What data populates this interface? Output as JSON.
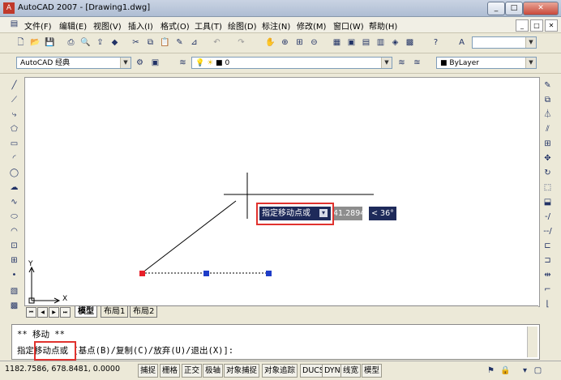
{
  "title_bar": {
    "title": "AutoCAD 2007 - [Drawing1.dwg]",
    "min": "_",
    "max": "□",
    "close": "✕"
  },
  "menu": [
    "文件(F)",
    "编辑(E)",
    "视图(V)",
    "插入(I)",
    "格式(O)",
    "工具(T)",
    "绘图(D)",
    "标注(N)",
    "修改(M)",
    "窗口(W)",
    "帮助(H)"
  ],
  "doc_controls": {
    "min": "_",
    "max": "□",
    "close": "✕"
  },
  "workspace": {
    "value": "AutoCAD 经典"
  },
  "layer": {
    "value": "0"
  },
  "color": {
    "value": "ByLayer"
  },
  "canvas": {
    "tooltip_label": "指定移动点或",
    "tooltip_dropdown": "▾",
    "coord_input": "41.2894",
    "angle_input": "< 36°",
    "ucs_x": "X",
    "ucs_y": "Y"
  },
  "tabs": {
    "model": "模型",
    "layout1": "布局1",
    "layout2": "布局2"
  },
  "command": {
    "line1": "** 移动 **",
    "line2": "指定移动点或 [基点(B)/复制(C)/放弃(U)/退出(X)]:"
  },
  "status": {
    "coords": "1182.7586, 678.8481, 0.0000",
    "buttons": [
      "捕捉",
      "栅格",
      "正交",
      "极轴",
      "对象捕捉",
      "对象追踪",
      "DUCS",
      "DYN",
      "线宽",
      "模型"
    ]
  },
  "colors": {
    "canvas_bg": "#ffffff",
    "grip_hot": "#e8202a",
    "grip_cold": "#1e3cc8",
    "tooltip_bg": "#1e2a5a",
    "highlight": "#e0322e"
  }
}
